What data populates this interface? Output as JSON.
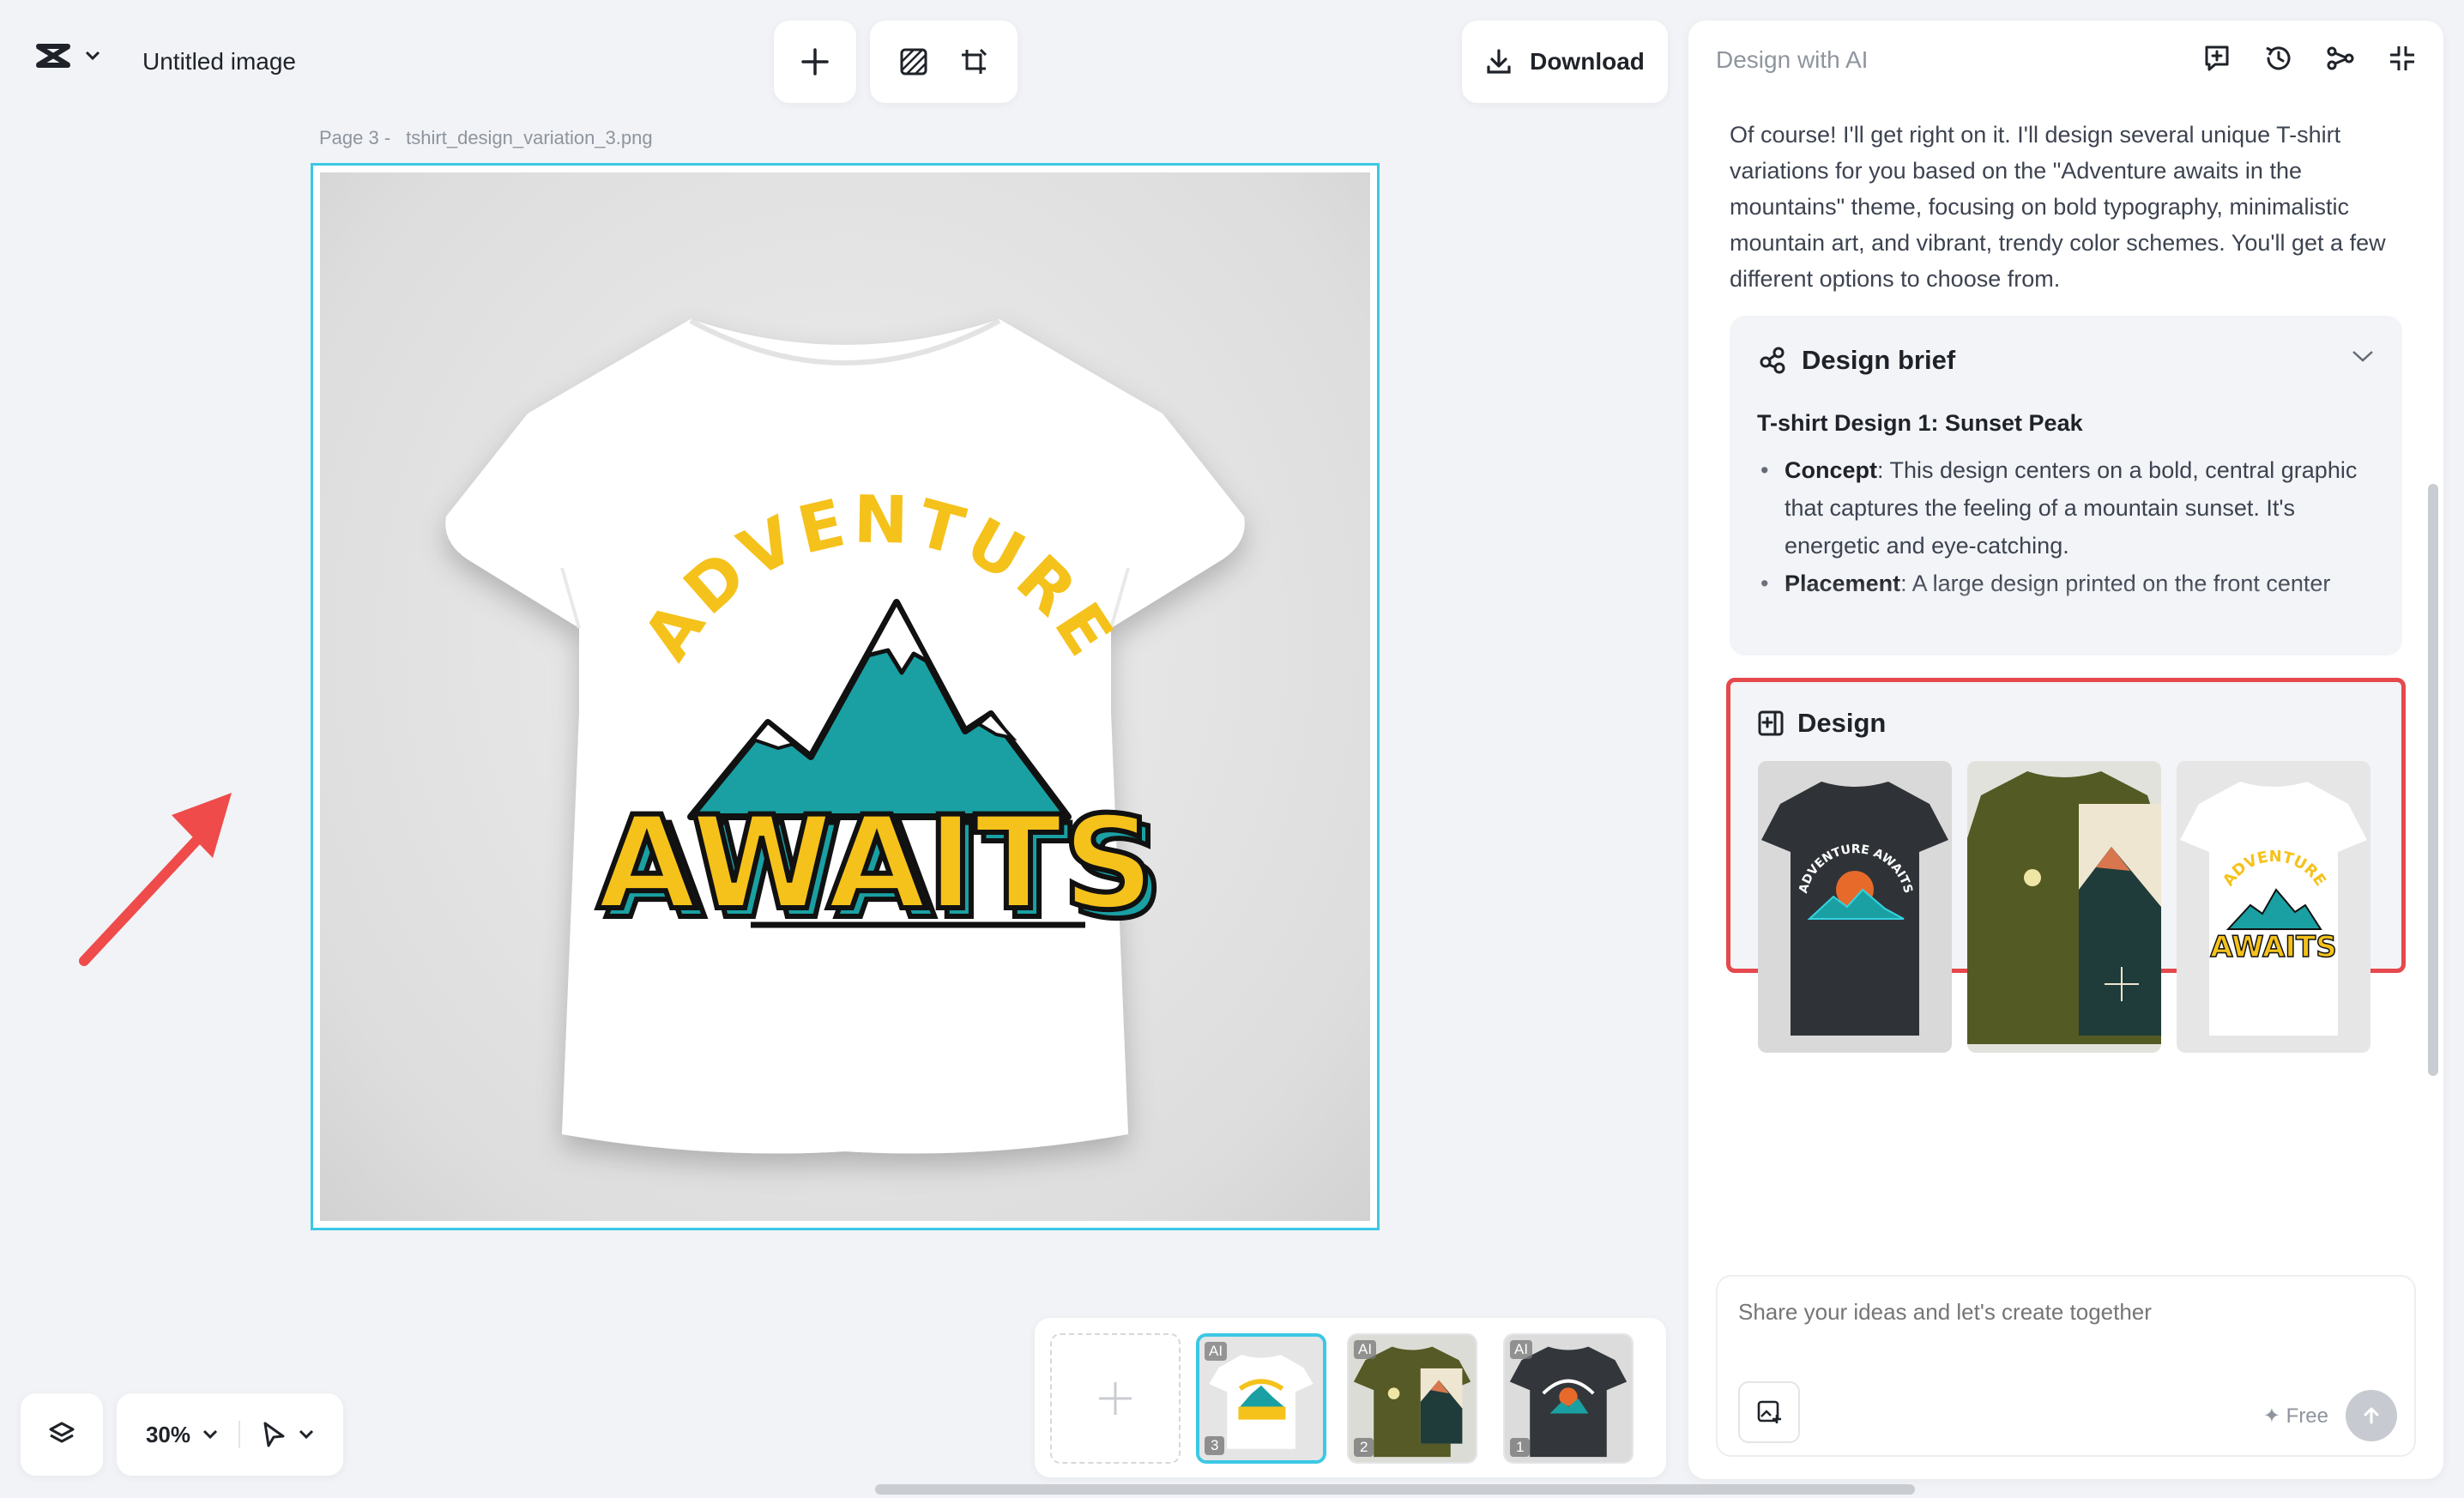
{
  "header": {
    "doc_title": "Untitled image",
    "download_label": "Download"
  },
  "canvas": {
    "page_label": "Page 3 -",
    "file_name": "tshirt_design_variation_3.png",
    "shirt_text_top": "ADVENTURE",
    "shirt_text_bottom": "AWAITS"
  },
  "bottom_bar": {
    "zoom": "30%"
  },
  "thumbnails": [
    {
      "badge": "AI",
      "number": "3",
      "shirt": "white",
      "selected": true
    },
    {
      "badge": "AI",
      "number": "2",
      "shirt": "olive",
      "selected": false
    },
    {
      "badge": "AI",
      "number": "1",
      "shirt": "charcoal",
      "selected": false
    }
  ],
  "panel": {
    "title": "Design with AI",
    "message": "Of course! I'll get right on it. I'll design several unique T-shirt variations for you based on the \"Adventure awaits in the mountains\" theme, focusing on bold typography, minimalistic mountain art, and vibrant, trendy color schemes. You'll get a few different options to choose from.",
    "brief": {
      "title": "Design brief",
      "subtitle": "T-shirt Design 1: Sunset Peak",
      "items": [
        {
          "label": "Concept",
          "text": ": This design centers on a bold, central graphic that captures the feeling of a mountain sunset. It's energetic and eye-catching."
        },
        {
          "label": "Placement",
          "text": ": A large design printed on the front center"
        }
      ]
    },
    "design": {
      "title": "Design",
      "mini_text_a": "ADVENTURE AWAITS",
      "mini_text_c_top": "ADVENTURE",
      "mini_text_c_bottom": "AWAITS"
    },
    "composer": {
      "placeholder": "Share your ideas and let's create together",
      "free_label": "✦ Free"
    }
  },
  "colors": {
    "accent_cyan": "#3cc8e4",
    "highlight_red": "#e5484d",
    "arrow_red": "#ef4b4b",
    "shirt_yellow": "#f5c21b",
    "mountain_teal": "#1aa0a3"
  }
}
